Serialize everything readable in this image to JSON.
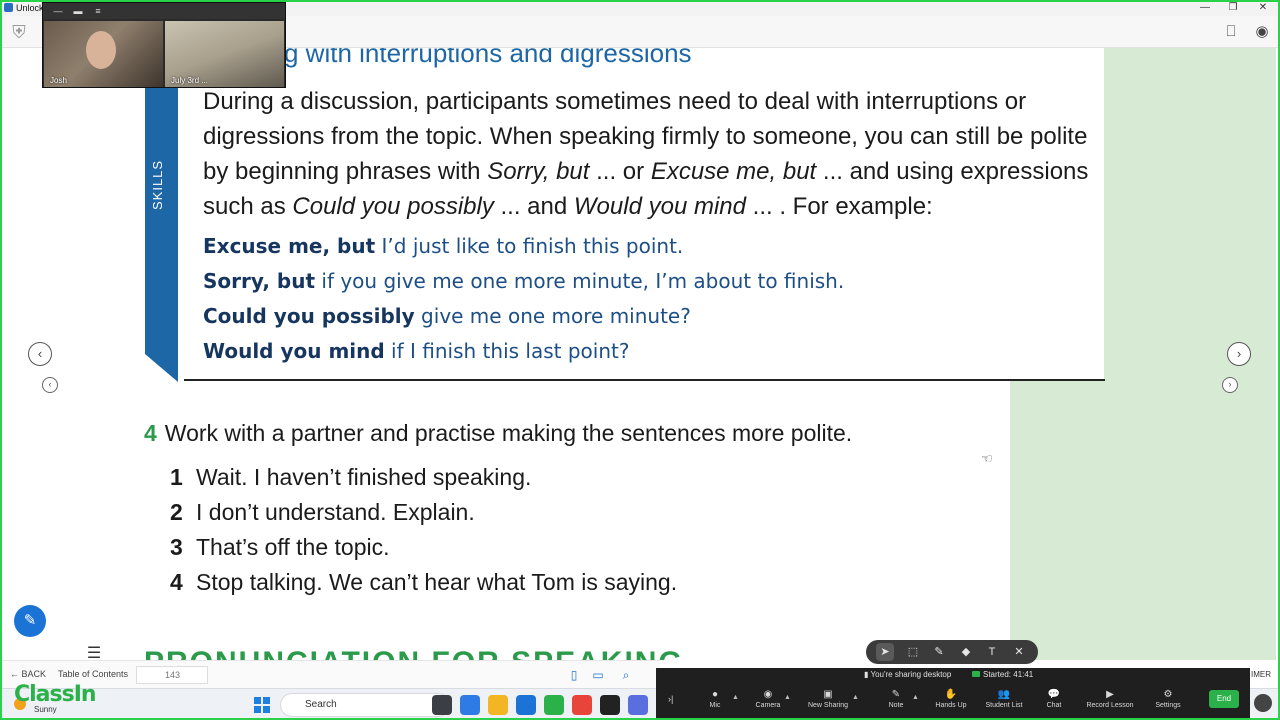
{
  "window": {
    "title": "Unlock",
    "controls": [
      "—",
      "❐",
      "✕"
    ]
  },
  "browser": {
    "logo_icon": "crest-logo-icon",
    "bookmark_icon": "bookmark-icon",
    "account_icon": "account-icon"
  },
  "webcam": {
    "participant_1": "Josh",
    "participant_2": "July 3rd ..."
  },
  "skills_box": {
    "section_title": "g with interruptions and digressions",
    "band_label": "SKILLS",
    "intro_parts": [
      "During a discussion, participants sometimes need to deal with interruptions or digressions from the topic. When speaking firmly to someone, you can still be polite by beginning phrases with ",
      "Sorry, but",
      " ... or ",
      "Excuse me, but",
      " ... and using expressions such as ",
      "Could you possibly",
      " ... and ",
      "Would you mind",
      " ... . For example:"
    ],
    "examples": [
      {
        "lead": "Excuse me, but",
        "rest": " I’d just like to finish this point."
      },
      {
        "lead": "Sorry, but",
        "rest": " if you give me one more minute, I’m about to finish."
      },
      {
        "lead": "Could you possibly",
        "rest": " give me one more minute?"
      },
      {
        "lead": "Would you mind",
        "rest": " if I finish this last point?"
      }
    ]
  },
  "task": {
    "number": "4",
    "instruction": "Work with a partner and practise making the sentences more polite.",
    "items": [
      {
        "num": "1",
        "text": "Wait. I haven’t finished speaking."
      },
      {
        "num": "2",
        "text": "I don’t understand. Explain."
      },
      {
        "num": "3",
        "text": "That’s off the topic."
      },
      {
        "num": "4",
        "text": "Stop talking. We can’t hear what Tom is saying."
      }
    ]
  },
  "next_section": {
    "title": "PRONUNCIATION FOR SPEAKING"
  },
  "navigation": {
    "prev_icon": "‹",
    "next_icon": "›"
  },
  "reader_bar": {
    "back_label": "BACK",
    "toc_label": "Table of Contents",
    "page_number": "143"
  },
  "brand": {
    "name": "ClassIn",
    "weather": "Sunny"
  },
  "annotation_toolbar": {
    "tools": [
      "pointer-icon",
      "select-icon",
      "pen-icon",
      "eraser-icon",
      "text-icon",
      "close-icon"
    ]
  },
  "meeting_bar": {
    "share_status": "You're sharing desktop",
    "started": "Started: 41:41",
    "controls": [
      {
        "label": "Mic",
        "icon": "mic-icon"
      },
      {
        "label": "Camera",
        "icon": "camera-icon"
      },
      {
        "label": "New Sharing",
        "icon": "share-icon"
      },
      {
        "label": "Note",
        "icon": "note-icon"
      },
      {
        "label": "Hands Up",
        "icon": "hand-icon"
      },
      {
        "label": "Student List",
        "icon": "students-icon"
      },
      {
        "label": "Chat",
        "icon": "chat-icon"
      },
      {
        "label": "Record Lesson",
        "icon": "record-icon"
      },
      {
        "label": "Settings",
        "icon": "settings-icon"
      }
    ],
    "end_label": "End",
    "timer_tag": "IMER"
  },
  "taskbar": {
    "search_placeholder": "Search"
  },
  "colors": {
    "accent_blue": "#1d67a6",
    "accent_green": "#2b9a4a",
    "panel_green": "#d7ead4",
    "frame_green": "#2bd14a"
  }
}
